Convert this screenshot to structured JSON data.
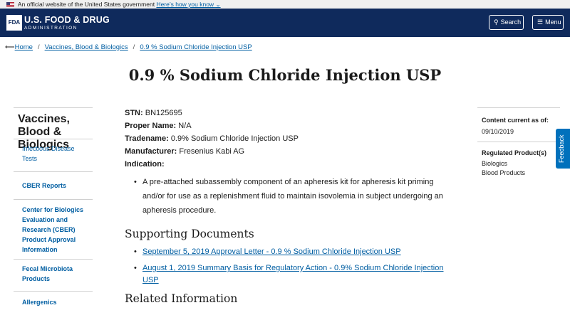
{
  "gov_banner": {
    "text": "An official website of the United States government",
    "link": "Here’s how you know",
    "chevron": "⌄"
  },
  "header": {
    "logo_mark": "FDA",
    "title": "U.S. FOOD & DRUG",
    "subtitle": "ADMINISTRATION",
    "search_label": "Search",
    "menu_label": "Menu"
  },
  "breadcrumb": {
    "arrow": "⟵",
    "items": [
      "Home",
      "Vaccines, Blood & Biologics",
      "0.9 % Sodium Chloride Injection USP"
    ],
    "separator": "/"
  },
  "page": {
    "title": "0.9 % Sodium Chloride Injection USP"
  },
  "leftnav": {
    "current": "Vaccines, Blood & Biologics",
    "items": [
      "Infectious Disease Tests",
      "CBER Reports",
      "Center for Biologics Evaluation and Research (CBER) Product Approval Information",
      "Fecal Microbiota Products",
      "Allergenics"
    ]
  },
  "product": {
    "stn_label": "STN:",
    "stn_value": "BN125695",
    "proper_name_label": "Proper Name:",
    "proper_name_value": "N/A",
    "tradename_label": "Tradename:",
    "tradename_value": "0.9% Sodium Chloride Injection USP",
    "manufacturer_label": "Manufacturer:",
    "manufacturer_value": "Fresenius Kabi AG",
    "indication_label": "Indication:",
    "indication_text": "A pre-attached subassembly component of an apheresis kit for apheresis kit priming and/or for use as a replenishment fluid to maintain isovolemia in subject undergoing an apheresis procedure."
  },
  "supporting": {
    "heading": "Supporting Documents",
    "docs": [
      "September 5, 2019 Approval Letter - 0.9 % Sodium Chloride Injection USP",
      "August 1, 2019 Summary Basis for Regulatory Action - 0.9% Sodium Chloride Injection USP"
    ]
  },
  "related": {
    "heading": "Related Information"
  },
  "sidebar_right": {
    "content_label": "Content current as of:",
    "date": "09/10/2019",
    "regulated_label": "Regulated Product(s)",
    "regulated_items": [
      "Biologics",
      "Blood Products"
    ]
  },
  "feedback_label": "Feedback",
  "colors": {
    "header_bg": "#0f2a5c",
    "link": "#005ea2",
    "feedback_bg": "#0071bc"
  }
}
